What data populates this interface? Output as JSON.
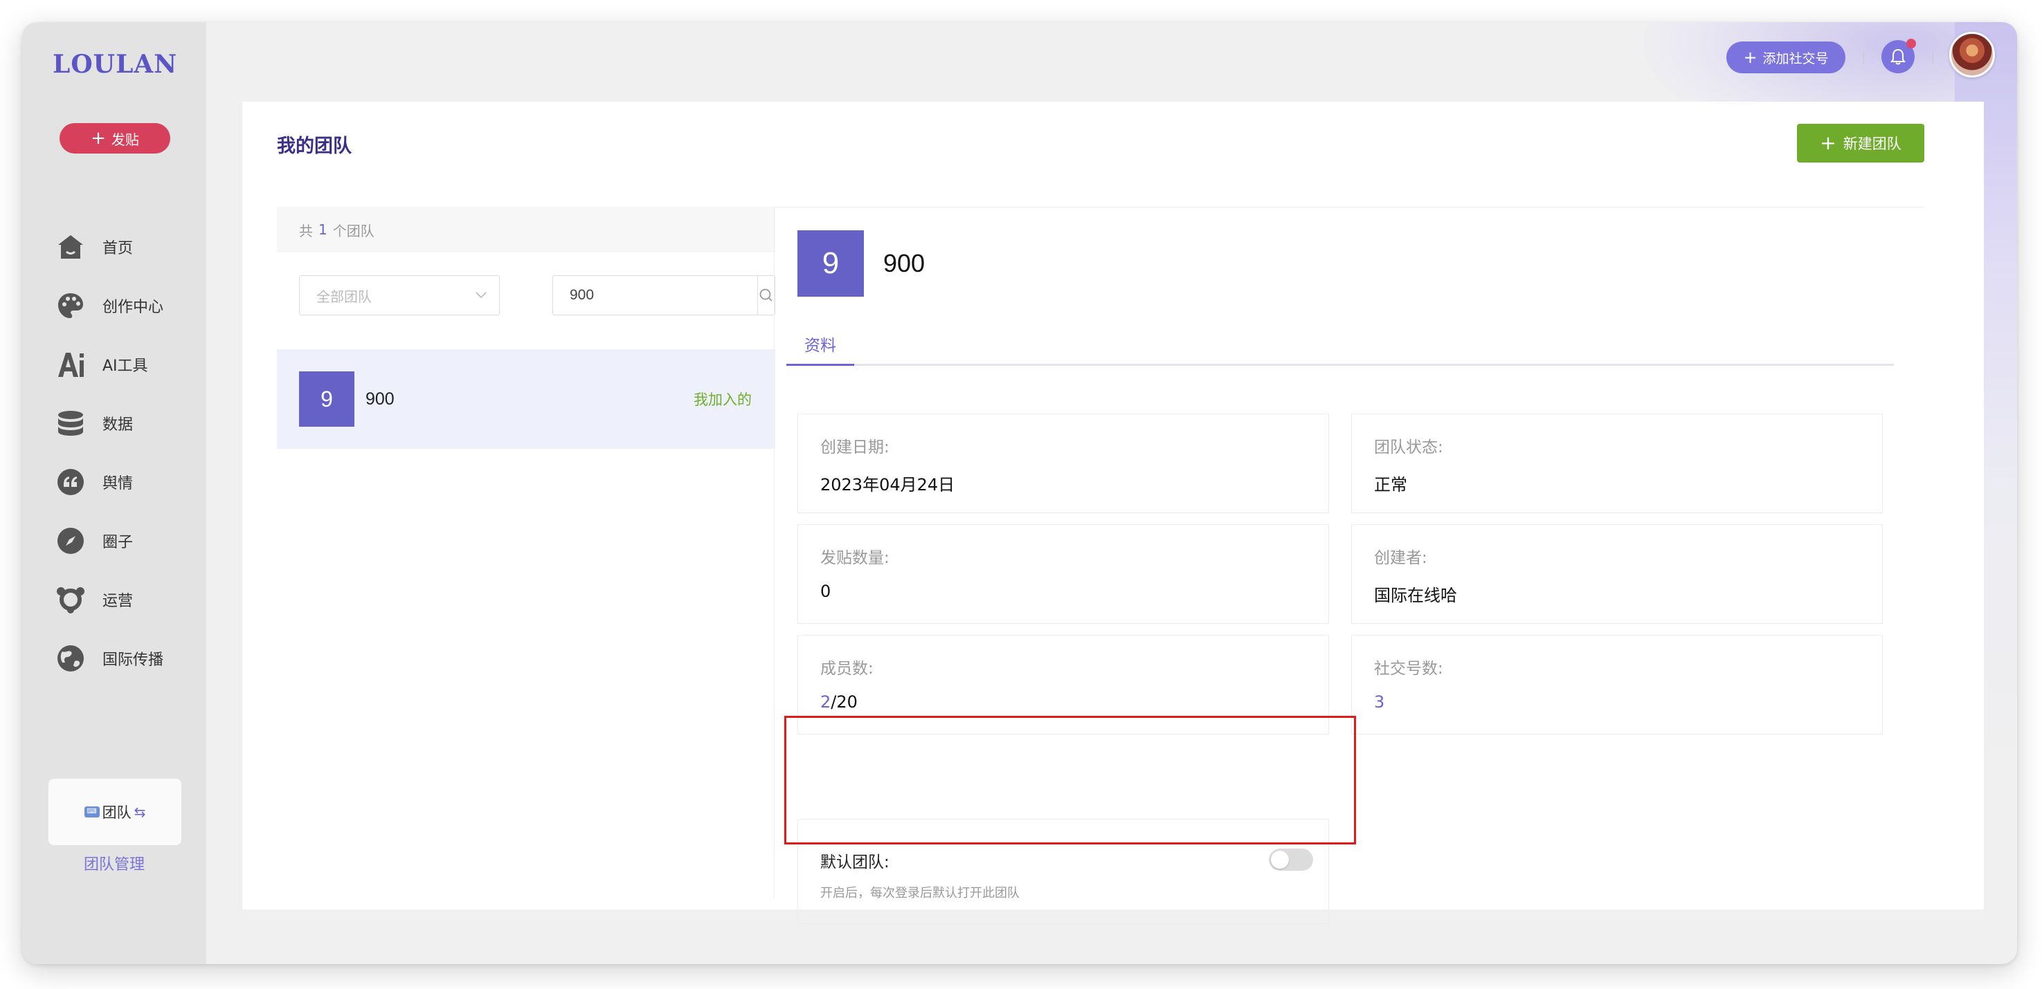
{
  "app": {
    "logo": "LOULAN",
    "post_button": "发贴",
    "nav": [
      {
        "label": "首页",
        "icon": "home-icon"
      },
      {
        "label": "创作中心",
        "icon": "palette-icon"
      },
      {
        "label": "AI工具",
        "icon": "ai-icon"
      },
      {
        "label": "数据",
        "icon": "database-icon"
      },
      {
        "label": "舆情",
        "icon": "quote-icon"
      },
      {
        "label": "圈子",
        "icon": "compass-icon"
      },
      {
        "label": "运营",
        "icon": "hub-icon"
      },
      {
        "label": "国际传播",
        "icon": "globe-icon"
      }
    ],
    "team_switch_label": "团队",
    "team_manage": "团队管理"
  },
  "topbar": {
    "add_social": "添加社交号"
  },
  "page": {
    "title": "我的团队",
    "new_team_button": "新建团队"
  },
  "list": {
    "count_prefix": "共",
    "count": "1",
    "count_suffix": "个团队",
    "filter_placeholder": "全部团队",
    "search_value": "900",
    "teams": [
      {
        "badge": "9",
        "name": "900",
        "tag": "我加入的"
      }
    ]
  },
  "detail": {
    "badge": "9",
    "name": "900",
    "tab": "资料",
    "created_label": "创建日期:",
    "created_value": "2023年04月24日",
    "status_label": "团队状态:",
    "status_value": "正常",
    "posts_label": "发贴数量:",
    "posts_value": "0",
    "creator_label": "创建者:",
    "creator_value": "国际在线哈",
    "members_label": "成员数:",
    "members_current": "2",
    "members_total": "/20",
    "social_label": "社交号数:",
    "social_value": "3",
    "default_label": "默认团队:",
    "default_hint": "开启后，每次登录后默认打开此团队",
    "default_enabled": false
  },
  "colors": {
    "brand": "#5b55c6",
    "accent": "#6a63d0",
    "post_red": "#d6405a",
    "green": "#6fac2c",
    "highlight": "#e31a1a"
  }
}
